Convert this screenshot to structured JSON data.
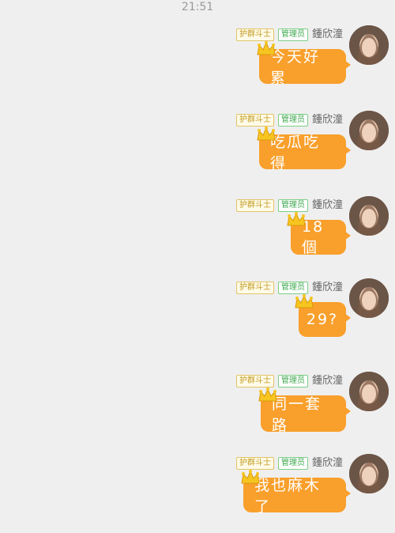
{
  "timestamp": "21:51",
  "messages": [
    {
      "name": "鍾欣潼",
      "badge_admin": "管理员",
      "badge_fan": "护群斗士",
      "text": "今天好累"
    },
    {
      "name": "鍾欣潼",
      "badge_admin": "管理员",
      "badge_fan": "护群斗士",
      "text": "吃瓜吃得"
    },
    {
      "name": "鍾欣潼",
      "badge_admin": "管理员",
      "badge_fan": "护群斗士",
      "text": "18個"
    },
    {
      "name": "鍾欣潼",
      "badge_admin": "管理员",
      "badge_fan": "护群斗士",
      "text": "29?"
    },
    {
      "name": "鍾欣潼",
      "badge_admin": "管理员",
      "badge_fan": "护群斗士",
      "text": "同一套路"
    },
    {
      "name": "鍾欣潼",
      "badge_admin": "管理员",
      "badge_fan": "护群斗士",
      "text": "我也麻木了"
    }
  ],
  "icons": {
    "avatar": "profile-photo",
    "crown": "crown-icon"
  },
  "colors": {
    "bubble": "#f99f2b",
    "admin_badge": "#3ea84f",
    "fan_badge": "#c19a1f",
    "background": "#efefef"
  }
}
